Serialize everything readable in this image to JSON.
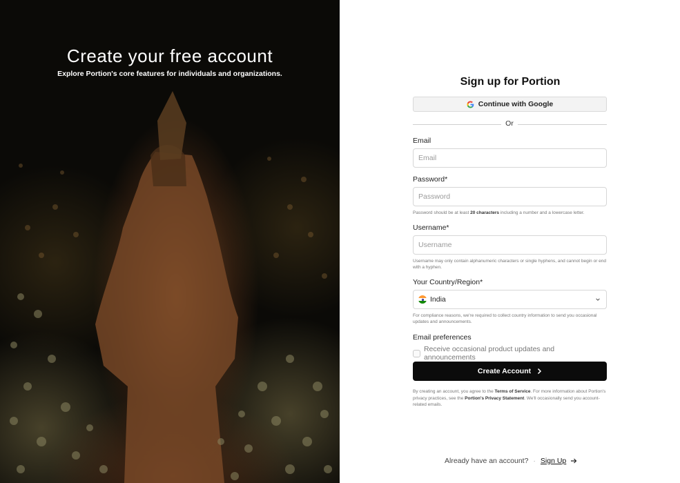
{
  "hero": {
    "title": "Create your free account",
    "subtitle": "Explore Portion's core features for individuals and organizations."
  },
  "form": {
    "title": "Sign up for Portion",
    "google_label": "Continue with Google",
    "or_label": "Or",
    "email": {
      "label": "Email",
      "placeholder": "Email",
      "value": ""
    },
    "password": {
      "label": "Password*",
      "placeholder": "Password",
      "value": "",
      "hint_prefix": "Password should be at least ",
      "hint_bold": "20 characters",
      "hint_suffix": " including a number and a lowercase letter."
    },
    "username": {
      "label": "Username*",
      "placeholder": "Username",
      "value": "",
      "hint": "Username may only contain alphanumeric characters or single hyphens, and cannot begin or end with a hyphen."
    },
    "country": {
      "label": "Your Country/Region*",
      "selected": "India",
      "flag_icon": "india-flag-icon",
      "hint": "For compliance reasons, we're required to collect country information to send you occasional updates and announcements."
    },
    "preferences": {
      "label": "Email preferences",
      "checkbox_label": "Receive occasional product updates and announcements",
      "checked": false
    },
    "create_label": "Create Account",
    "legal": {
      "part1": "By creating an account, you agree to the ",
      "terms": "Terms of Service",
      "part2": ". For more information about Portion's privacy practices, see the ",
      "privacy": "Portion's Privacy Statement",
      "part3": ". We'll occasionally send you account-related emails."
    }
  },
  "footer": {
    "already_text": "Already have an account?",
    "separator": "·",
    "signup_label": "Sign Up"
  },
  "colors": {
    "primary_button": "#0b0b0b",
    "hero_background": "#0b0a07"
  }
}
